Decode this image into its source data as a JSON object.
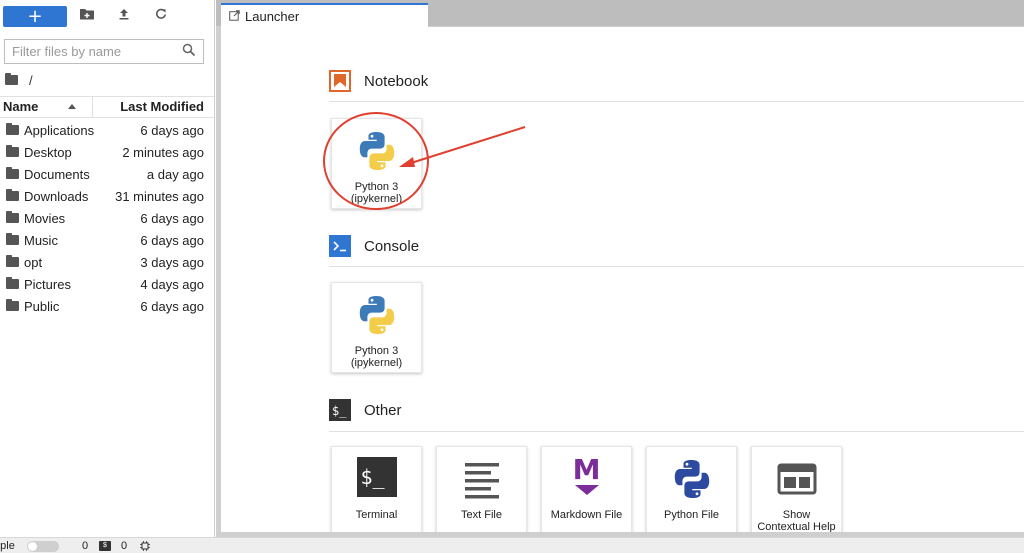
{
  "sidebar": {
    "new_label": "+",
    "search_placeholder": "Filter files by name",
    "breadcrumb": "/",
    "columns": {
      "name": "Name",
      "modified": "Last Modified"
    },
    "files": [
      {
        "name": "Applications",
        "modified": "6 days ago"
      },
      {
        "name": "Desktop",
        "modified": "2 minutes ago"
      },
      {
        "name": "Documents",
        "modified": "a day ago"
      },
      {
        "name": "Downloads",
        "modified": "31 minutes ago"
      },
      {
        "name": "Movies",
        "modified": "6 days ago"
      },
      {
        "name": "Music",
        "modified": "6 days ago"
      },
      {
        "name": "opt",
        "modified": "3 days ago"
      },
      {
        "name": "Pictures",
        "modified": "4 days ago"
      },
      {
        "name": "Public",
        "modified": "6 days ago"
      }
    ]
  },
  "tab": {
    "label": "Launcher"
  },
  "launcher": {
    "sections": {
      "notebook": "Notebook",
      "console": "Console",
      "other": "Other"
    },
    "notebook_card": {
      "line1": "Python 3",
      "line2": "(ipykernel)"
    },
    "console_card": {
      "line1": "Python 3",
      "line2": "(ipykernel)"
    },
    "other_cards": {
      "terminal": "Terminal",
      "text_file": "Text File",
      "markdown_file": "Markdown File",
      "python_file": "Python File",
      "help_line1": "Show",
      "help_line2": "Contextual Help"
    },
    "terminal_glyph": "$_",
    "markdown_glyph": "M"
  },
  "statusbar": {
    "mode_label": "mple",
    "terminals_count": "0",
    "kernels_count": "0",
    "terminal_badge": "$"
  },
  "colors": {
    "accent_blue": "#2f76d2",
    "notebook_orange": "#e0662b",
    "annotation_red": "#e0402f",
    "markdown_purple": "#7b2d9a"
  },
  "icons": {
    "new_folder": "new-folder-icon",
    "upload": "upload-icon",
    "refresh": "refresh-icon",
    "search": "search-icon",
    "folder": "folder-icon"
  }
}
